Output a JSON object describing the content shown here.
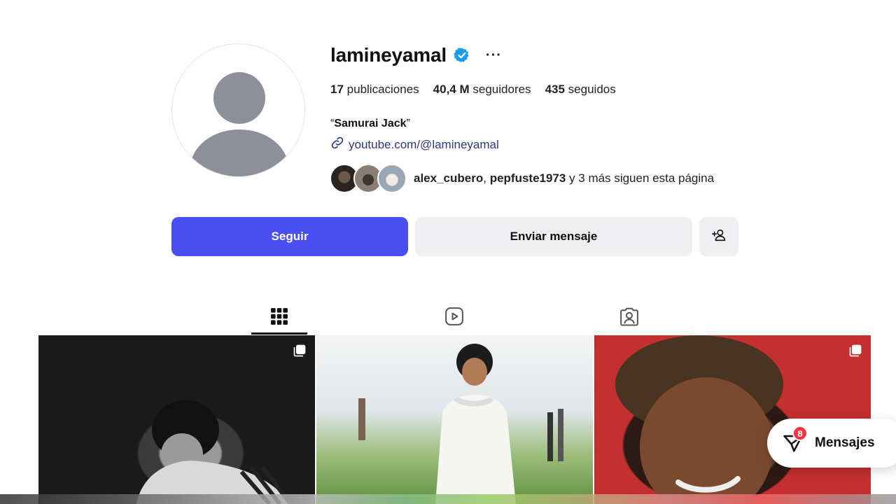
{
  "profile": {
    "username": "lamineyamal",
    "more_label": "···",
    "stats": {
      "posts_count": "17",
      "posts_label": "publicaciones",
      "followers_count": "40,4 M",
      "followers_label": "seguidores",
      "following_count": "435",
      "following_label": "seguidos"
    },
    "bio_open": "“",
    "bio_name": "Samurai Jack",
    "bio_close": "”",
    "link": "youtube.com/@lamineyamal",
    "followed_by": {
      "user1": "alex_cubero",
      "separator": ", ",
      "user2": "pepfuste1973",
      "rest": " y 3 más siguen esta página"
    }
  },
  "actions": {
    "follow_label": "Seguir",
    "message_label": "Enviar mensaje"
  },
  "tabs": [
    {
      "name": "posts",
      "icon": "grid-icon",
      "active": true
    },
    {
      "name": "reels",
      "icon": "reels-icon",
      "active": false
    },
    {
      "name": "tagged",
      "icon": "tagged-icon",
      "active": false
    }
  ],
  "messages": {
    "label": "Mensajes",
    "badge": "8"
  },
  "colors": {
    "accent": "#4a4ff2",
    "verified": "#1d9bf0",
    "badge": "#ff3040"
  }
}
